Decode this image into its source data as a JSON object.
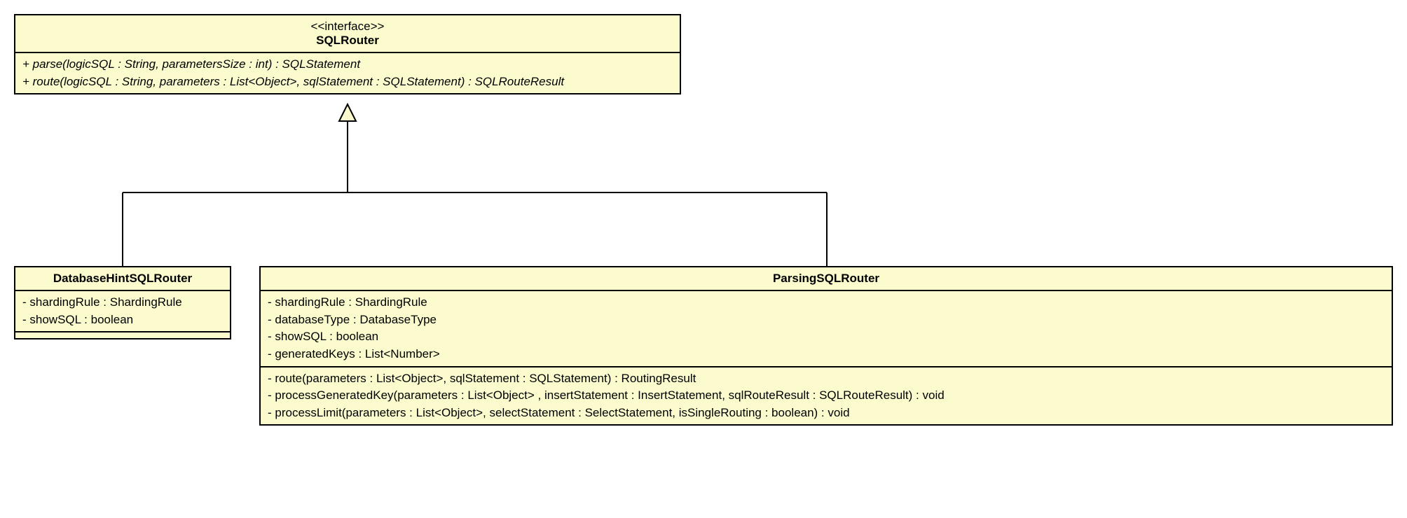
{
  "interface": {
    "stereotype": "<<interface>>",
    "name": "SQLRouter",
    "methods": [
      "+ parse(logicSQL : String, parametersSize : int) : SQLStatement",
      "+ route(logicSQL : String, parameters : List<Object>, sqlStatement : SQLStatement) : SQLRouteResult"
    ]
  },
  "dbhint": {
    "name": "DatabaseHintSQLRouter",
    "attributes": [
      "- shardingRule : ShardingRule",
      "- showSQL : boolean"
    ]
  },
  "parsing": {
    "name": "ParsingSQLRouter",
    "attributes": [
      "- shardingRule : ShardingRule",
      "- databaseType : DatabaseType",
      "- showSQL : boolean",
      "- generatedKeys : List<Number>"
    ],
    "methods": [
      "- route(parameters : List<Object>, sqlStatement : SQLStatement) : RoutingResult",
      "- processGeneratedKey(parameters : List<Object> , insertStatement : InsertStatement, sqlRouteResult : SQLRouteResult) : void",
      "- processLimit(parameters : List<Object>, selectStatement : SelectStatement, isSingleRouting : boolean) : void"
    ]
  }
}
